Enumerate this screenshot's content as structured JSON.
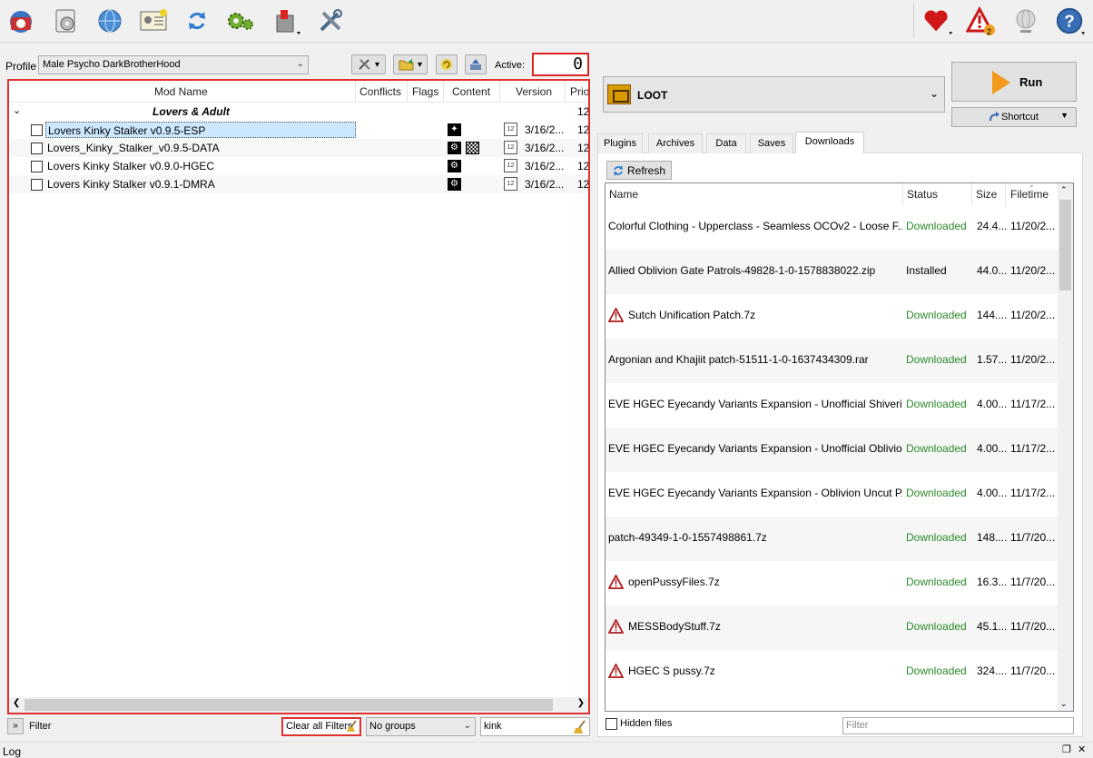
{
  "toolbar": {
    "icons": [
      "profile-icon",
      "install-mod-icon",
      "nexus-icon",
      "mod-info-icon",
      "refresh-icon",
      "settings-icon",
      "tools-icon",
      "configure-icon"
    ],
    "right_icons": [
      "endorse-heart-icon",
      "warning-icon",
      "update-icon",
      "help-icon"
    ],
    "warning_count": "2"
  },
  "profile": {
    "label": "Profile",
    "value": "Male Psycho DarkBrotherHood"
  },
  "active": {
    "label": "Active:",
    "value": "0"
  },
  "mod_list": {
    "columns": {
      "name": "Mod Name",
      "conflicts": "Conflicts",
      "flags": "Flags",
      "content": "Content",
      "version": "Version",
      "priority": "Prio"
    },
    "group": {
      "name": "Lovers & Adult",
      "priority": "12"
    },
    "rows": [
      {
        "name": "Lovers Kinky Stalker v0.9.5-ESP",
        "version": "3/16/2...",
        "priority": "12",
        "selected": true
      },
      {
        "name": "Lovers_Kinky_Stalker_v0.9.5-DATA",
        "version": "3/16/2...",
        "priority": "12"
      },
      {
        "name": "Lovers Kinky Stalker v0.9.0-HGEC",
        "version": "3/16/2...",
        "priority": "12"
      },
      {
        "name": "Lovers Kinky Stalker v0.9.1-DMRA",
        "version": "3/16/2...",
        "priority": "12"
      }
    ]
  },
  "filter_bar": {
    "toggle": "»",
    "filter_label": "Filter",
    "clear_filters": "Clear all Filters",
    "groups": "No groups",
    "search": "kink"
  },
  "log": {
    "label": "Log"
  },
  "executable": {
    "name": "LOOT",
    "run": "Run",
    "shortcut": "Shortcut"
  },
  "tabs": [
    "Plugins",
    "Archives",
    "Data",
    "Saves",
    "Downloads"
  ],
  "downloads": {
    "refresh": "Refresh",
    "columns": {
      "name": "Name",
      "status": "Status",
      "size": "Size",
      "filetime": "Filetime"
    },
    "rows": [
      {
        "name": "Colorful Clothing - Upperclass - Seamless OCOv2 - Loose F...",
        "status": "Downloaded",
        "size": "24.4...",
        "time": "11/20/2...",
        "warn": false
      },
      {
        "name": "Allied Oblivion Gate Patrols-49828-1-0-1578838022.zip",
        "status": "Installed",
        "size": "44.0...",
        "time": "11/20/2...",
        "warn": false
      },
      {
        "name": "Sutch Unification Patch.7z",
        "status": "Downloaded",
        "size": "144....",
        "time": "11/20/2...",
        "warn": true
      },
      {
        "name": "Argonian and Khajiit patch-51511-1-0-1637434309.rar",
        "status": "Downloaded",
        "size": "1.57...",
        "time": "11/20/2...",
        "warn": false
      },
      {
        "name": "EVE HGEC Eyecandy Variants Expansion - Unofficial Shiveri...",
        "status": "Downloaded",
        "size": "4.00...",
        "time": "11/17/2...",
        "warn": false
      },
      {
        "name": "EVE HGEC Eyecandy Variants Expansion - Unofficial Oblivio...",
        "status": "Downloaded",
        "size": "4.00...",
        "time": "11/17/2...",
        "warn": false
      },
      {
        "name": "EVE HGEC Eyecandy Variants Expansion - Oblivion Uncut P...",
        "status": "Downloaded",
        "size": "4.00...",
        "time": "11/17/2...",
        "warn": false
      },
      {
        "name": "patch-49349-1-0-1557498861.7z",
        "status": "Downloaded",
        "size": "148....",
        "time": "11/7/20...",
        "warn": false
      },
      {
        "name": "openPussyFiles.7z",
        "status": "Downloaded",
        "size": "16.3...",
        "time": "11/7/20...",
        "warn": true
      },
      {
        "name": "MESSBodyStuff.7z",
        "status": "Downloaded",
        "size": "45.1...",
        "time": "11/7/20...",
        "warn": true
      },
      {
        "name": "HGEC S pussy.7z",
        "status": "Downloaded",
        "size": "324....",
        "time": "11/7/20...",
        "warn": true
      }
    ],
    "hidden_files": "Hidden files",
    "filter_placeholder": "Filter"
  }
}
